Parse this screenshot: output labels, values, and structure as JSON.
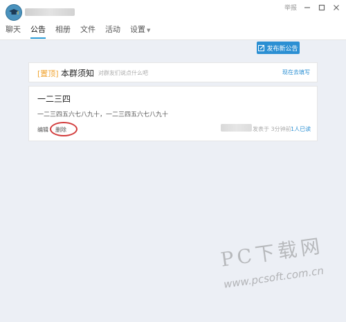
{
  "window": {
    "report_label": "举报"
  },
  "nav": {
    "tabs": [
      {
        "label": "聊天"
      },
      {
        "label": "公告"
      },
      {
        "label": "相册"
      },
      {
        "label": "文件"
      },
      {
        "label": "活动"
      },
      {
        "label": "设置"
      }
    ]
  },
  "toolbar": {
    "publish_label": "发布新公告"
  },
  "rules_card": {
    "pin_label": "[置顶]",
    "title": "本群须知",
    "hint": "对群友们说点什么吧",
    "fill_label": "现在去填写"
  },
  "notice": {
    "title": "一二三四",
    "body": "一二三四五六七八九十，一二三四五六七八九十",
    "edit_label": "编辑",
    "delete_label": "删除",
    "time": "发表于 3分钟前",
    "read": "1人已读"
  },
  "watermark": {
    "main": "PC下载网",
    "url": "www.pcsoft.com.cn"
  },
  "colors": {
    "accent": "#2b8fd3",
    "tab_active": "#2b9bd6",
    "pin": "#f0a330",
    "highlight_circle": "#d23a3a",
    "content_bg": "#eceff5"
  }
}
